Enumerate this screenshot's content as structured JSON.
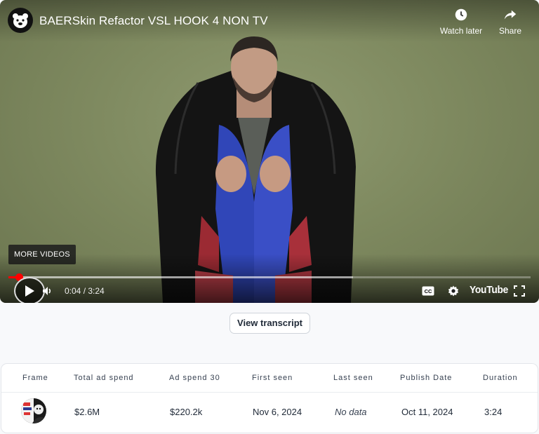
{
  "player": {
    "title": "BAERSkin Refactor VSL HOOK 4 NON TV",
    "watch_later": "Watch later",
    "share": "Share",
    "more_videos": "MORE VIDEOS",
    "time": "0:04 / 3:24",
    "played_fraction": 0.02,
    "buffered_fraction": 0.66,
    "logo_text": "YouTube",
    "icons": [
      "bear-avatar-icon",
      "clock-icon",
      "share-arrow-icon",
      "play-icon",
      "volume-icon",
      "cc-icon",
      "gear-icon",
      "fullscreen-icon"
    ]
  },
  "transcript_button": "View transcript",
  "table": {
    "headers": [
      "Frame",
      "Total ad spend",
      "Ad spend 30",
      "First seen",
      "Last seen",
      "Publish Date",
      "Duration"
    ],
    "row": {
      "total_ad_spend": "$2.6M",
      "ad_spend_30": "$220.2k",
      "first_seen": "Nov 6, 2024",
      "last_seen": "No data",
      "publish_date": "Oct 11, 2024",
      "duration": "3:24"
    }
  },
  "colors": {
    "accent_red": "#ff0000",
    "backdrop": "#7f8a60"
  }
}
